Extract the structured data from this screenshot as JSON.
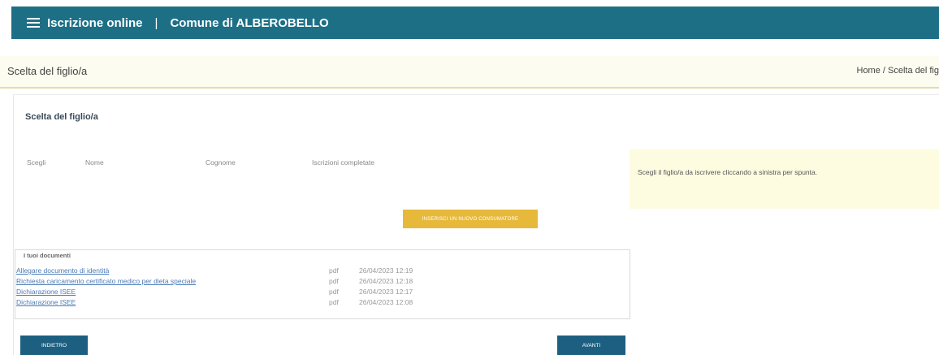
{
  "header": {
    "app_title": "Iscrizione online",
    "separator": "|",
    "comune": "Comune di ALBEROBELLO"
  },
  "crumbbar": {
    "page_title": "Scelta del figlio/a",
    "breadcrumb": "Home / Scelta del fig"
  },
  "panel": {
    "title": "Scelta del figlio/a",
    "columns": [
      "Scegli",
      "Nome",
      "Cognome",
      "Iscrizioni completate"
    ],
    "new_button": "INSERISCI UN NUOVO CONSUMATORE",
    "info_text": "Scegli il figlio/a da iscrivere cliccando a sinistra per spunta."
  },
  "documents": {
    "title": "I tuoi documenti",
    "items": [
      {
        "name": "Allegare documento di identità",
        "type": "pdf",
        "date": "26/04/2023 12:19"
      },
      {
        "name": "Richiesta caricamento certificato medico per dieta speciale",
        "type": "pdf",
        "date": "26/04/2023 12:18"
      },
      {
        "name": "Dichiarazione ISEE",
        "type": "pdf",
        "date": "26/04/2023 12:17"
      },
      {
        "name": "Dichiarazione ISEE",
        "type": "pdf",
        "date": "26/04/2023 12:08"
      }
    ]
  },
  "buttons": {
    "back": "INDIETRO",
    "next": "AVANTI"
  }
}
